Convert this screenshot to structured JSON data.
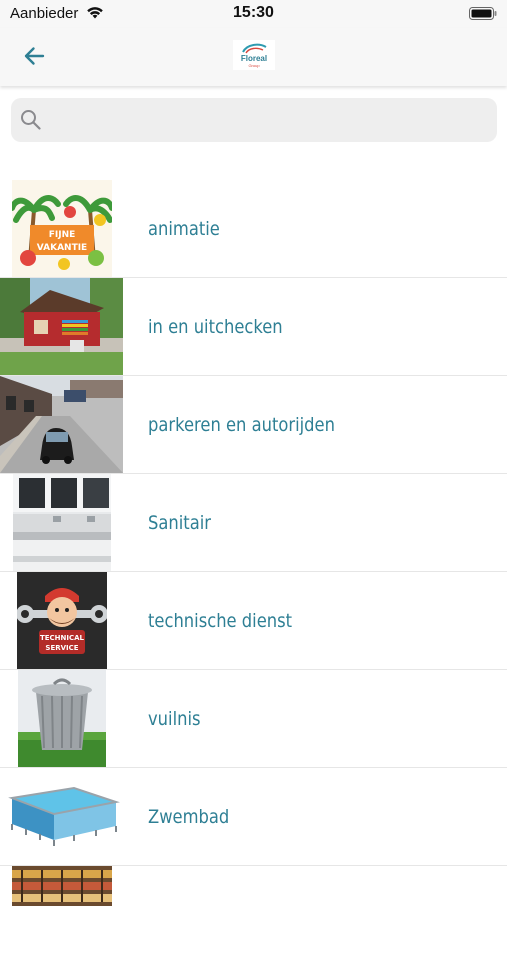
{
  "status_bar": {
    "carrier": "Aanbieder",
    "time": "15:30",
    "wifi_icon": "wifi-icon",
    "battery_icon": "battery-icon"
  },
  "nav": {
    "back_icon": "arrow-left-icon",
    "logo_text_top": "Floreal",
    "logo_text_bottom": "Group",
    "accent_color": "#2e7f94"
  },
  "search": {
    "value": "",
    "placeholder": "",
    "icon": "magnifier-icon"
  },
  "items": [
    {
      "label": "animatie",
      "thumb_text": [
        "FIJNE",
        "VAKANTIE"
      ]
    },
    {
      "label": "in en uitchecken"
    },
    {
      "label": "parkeren en autorijden"
    },
    {
      "label": "Sanitair"
    },
    {
      "label": "technische dienst",
      "thumb_text": [
        "TECHNICAL",
        "SERVICE"
      ]
    },
    {
      "label": "vuilnis"
    },
    {
      "label": "Zwembad"
    },
    {
      "label": ""
    }
  ]
}
